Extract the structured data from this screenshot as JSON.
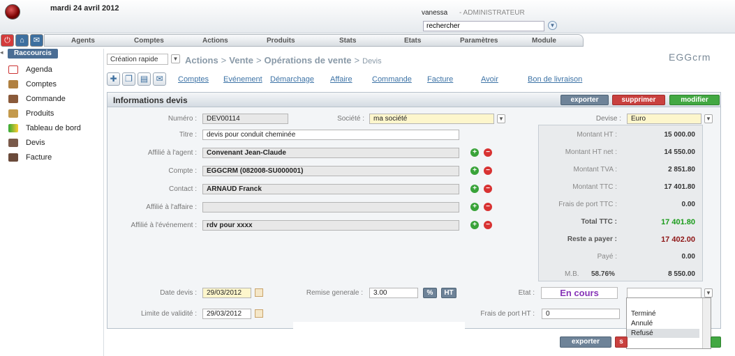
{
  "header": {
    "date": "mardi 24 avril 2012",
    "user": "vanessa",
    "role": "- ADMINISTRATEUR",
    "search_value": "rechercher"
  },
  "menu": [
    "Agents",
    "Comptes",
    "Actions",
    "Produits",
    "Stats",
    "Etats",
    "Paramètres",
    "Module"
  ],
  "sidebar": {
    "title": "Raccourcis",
    "items": [
      "Agenda",
      "Comptes",
      "Commande",
      "Produits",
      "Tableau de bord",
      "Devis",
      "Facture"
    ]
  },
  "breadcrumb": {
    "quick_create": "Création rapide",
    "parts": [
      "Actions",
      "Vente",
      "Opérations de vente",
      "Devis"
    ],
    "brand": "EGGcrm"
  },
  "subnav": [
    "Comptes",
    "Evénement",
    "Démarchage",
    "Affaire",
    "Commande",
    "Facture",
    "Avoir",
    "Bon de livraison"
  ],
  "panel": {
    "title": "Informations devis",
    "export_label": "exporter",
    "delete_label": "supprimer",
    "modify_label": "modifier"
  },
  "form": {
    "numero_label": "Numéro :",
    "numero": "DEV00114",
    "societe_label": "Société :",
    "societe": "ma société",
    "devise_label": "Devise :",
    "devise": "Euro",
    "titre_label": "Titre :",
    "titre": "devis pour conduit cheminée",
    "agent_label": "Affilié à l'agent :",
    "agent": "Convenant Jean-Claude",
    "compte_label": "Compte :",
    "compte": "EGGCRM (082008-SU000001)",
    "contact_label": "Contact :",
    "contact": "ARNAUD Franck",
    "affaire_label": "Affilié à l'affaire :",
    "affaire": "",
    "evenement_label": "Affilié à l'événement :",
    "evenement": "rdv pour xxxx",
    "date_label": "Date devis :",
    "date": "29/03/2012",
    "remise_label": "Remise generale :",
    "remise": "3.00",
    "remise_pct": "%",
    "remise_ht": "HT",
    "etat_label": "Etat :",
    "etat": "En cours",
    "limite_label": "Limite de validité :",
    "limite": "29/03/2012",
    "frais_ht_label": "Frais de port HT :",
    "frais_ht": "0"
  },
  "totals": {
    "ht_label": "Montant HT :",
    "ht": "15 000.00",
    "htnet_label": "Montant HT net :",
    "htnet": "14 550.00",
    "tva_label": "Montant TVA :",
    "tva": "2 851.80",
    "ttc_label": "Montant TTC :",
    "ttc": "17 401.80",
    "frais_label": "Frais de port TTC :",
    "frais": "0.00",
    "total_label": "Total TTC :",
    "total": "17 401.80",
    "reste_label": "Reste a payer :",
    "reste": "17 402.00",
    "paye_label": "Payé :",
    "paye": "0.00",
    "mb_label": "M.B.",
    "mb_pct": "58.76%",
    "mb": "8 550.00"
  },
  "etat_dropdown": [
    "Terminé",
    "Annulé",
    "Refusé"
  ],
  "footer": {
    "export_label": "exporter",
    "delete_label": "s"
  },
  "colors": {
    "accent": "#3d6f9f",
    "delete": "#c9403e",
    "modify": "#42a842",
    "status": "#8633b7"
  }
}
